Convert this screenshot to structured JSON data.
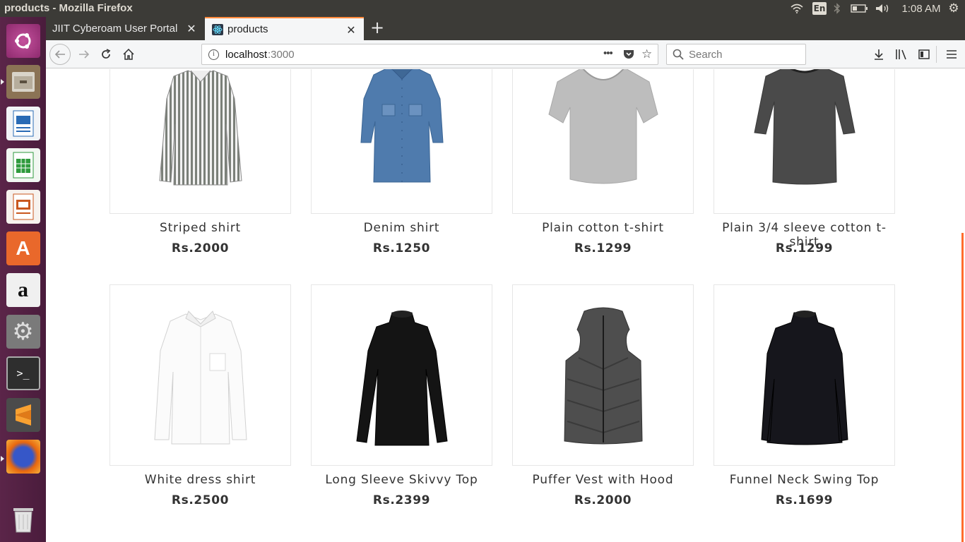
{
  "window": {
    "title": "products - Mozilla Firefox"
  },
  "panel": {
    "keyboard": "En",
    "time": "1:08 AM"
  },
  "tabs": [
    {
      "label": "JIIT Cyberoam User Portal",
      "close": "✕"
    },
    {
      "label": "products",
      "close": "✕"
    }
  ],
  "newtab_label": "+",
  "urlbar": {
    "host": "localhost",
    "port": ":3000"
  },
  "search": {
    "placeholder": "Search"
  },
  "launcher": [
    "ubuntu-dash",
    "files",
    "writer",
    "calc",
    "impress",
    "software-center",
    "amazon",
    "system-settings",
    "terminal",
    "sublime-text",
    "firefox",
    "trash"
  ],
  "products": [
    {
      "name": "Striped shirt",
      "price": "Rs.2000",
      "icon": "striped-shirt"
    },
    {
      "name": "Denim shirt",
      "price": "Rs.1250",
      "icon": "denim-shirt"
    },
    {
      "name": "Plain cotton t-shirt",
      "price": "Rs.1299",
      "icon": "grey-tshirt"
    },
    {
      "name": "Plain 3/4 sleeve cotton t-shirt",
      "price": "Rs.1299",
      "icon": "dark-tshirt"
    },
    {
      "name": "White dress shirt",
      "price": "Rs.2500",
      "icon": "white-shirt"
    },
    {
      "name": "Long Sleeve Skivvy Top",
      "price": "Rs.2399",
      "icon": "black-top"
    },
    {
      "name": "Puffer Vest with Hood",
      "price": "Rs.2000",
      "icon": "puffer-vest"
    },
    {
      "name": "Funnel Neck Swing Top",
      "price": "Rs.1699",
      "icon": "swing-top"
    }
  ],
  "colors": {
    "accent": "#ff8b3d",
    "launcher": "#4a1c3c",
    "panel": "#3c3b37",
    "scroll": "#ff6c2c"
  }
}
